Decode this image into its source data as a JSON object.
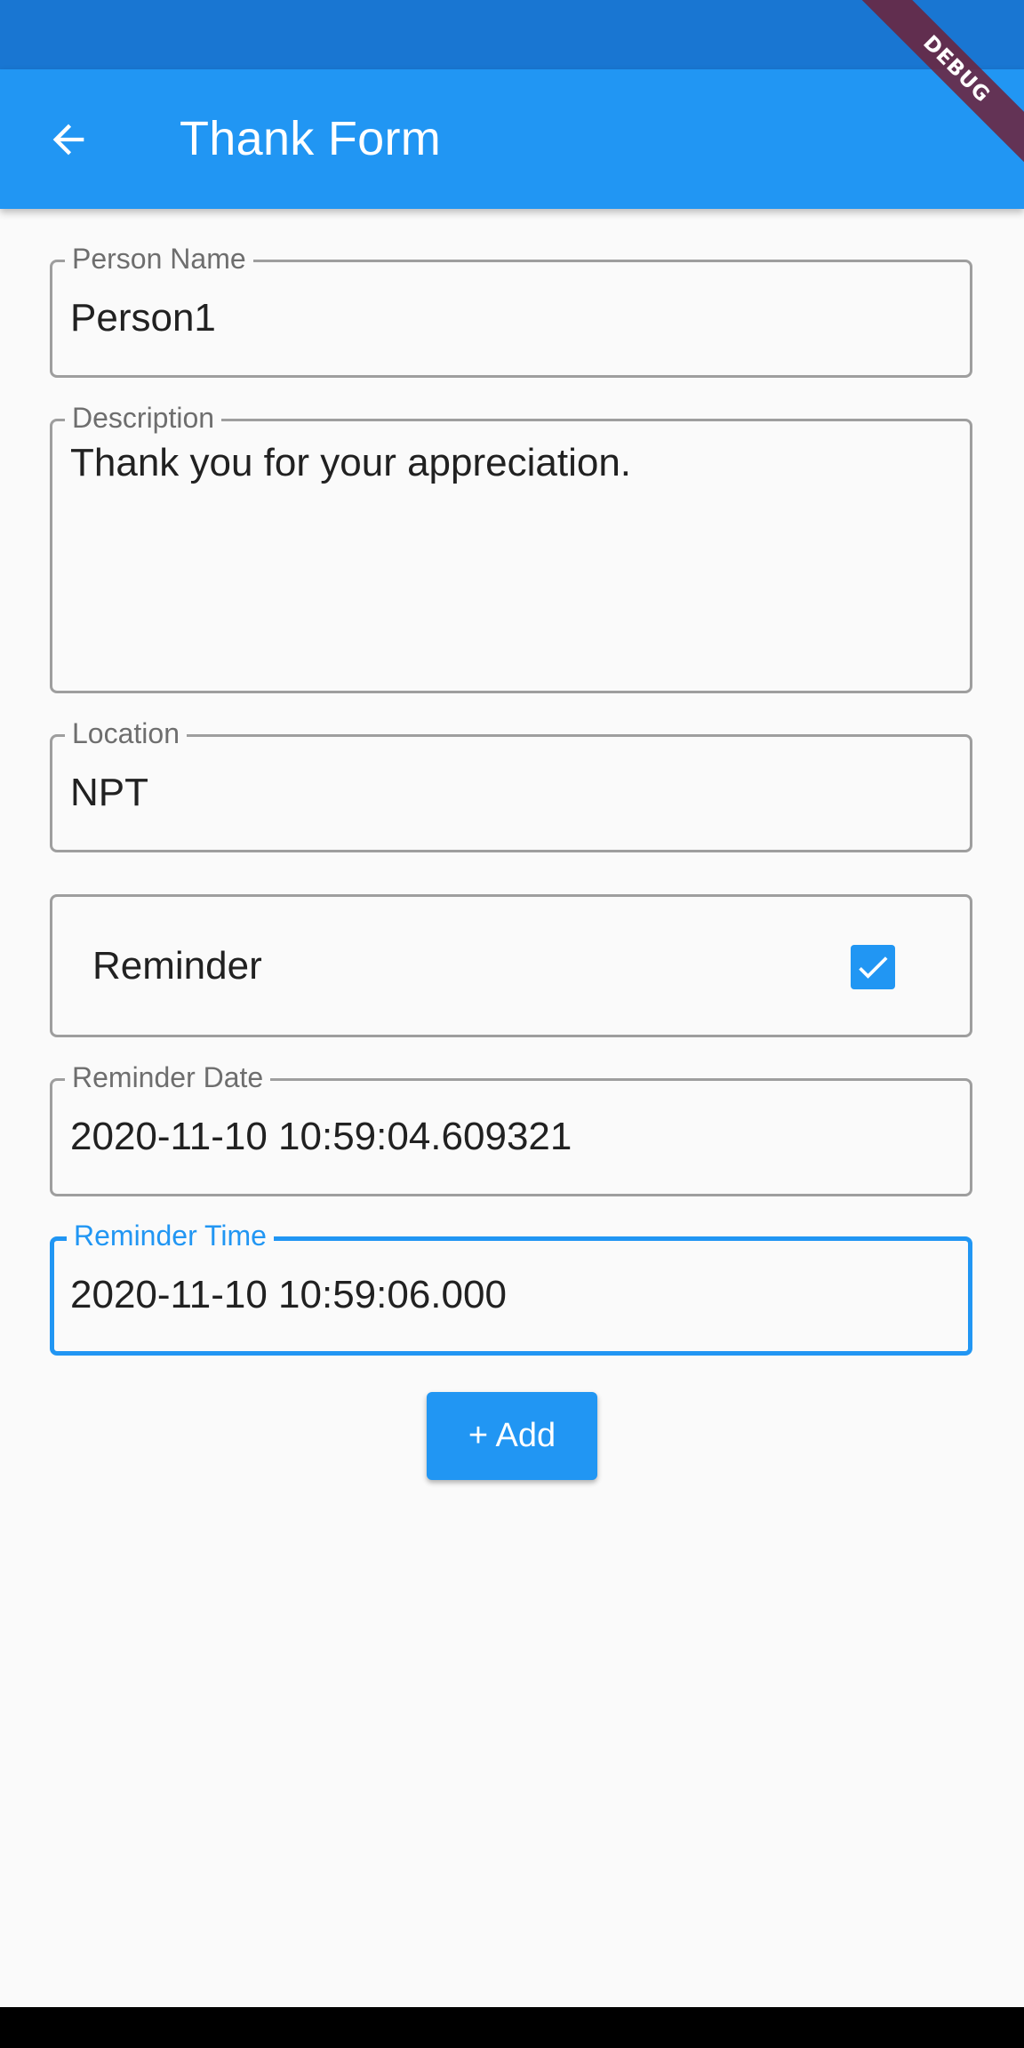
{
  "app_bar": {
    "title": "Thank Form",
    "back_icon": "arrow-back-icon",
    "color": "#2196F3",
    "status_bar_color": "#1976D2"
  },
  "debug_banner": {
    "label": "DEBUG",
    "color": "#6F2238"
  },
  "form": {
    "person_name": {
      "label": "Person Name",
      "value": "Person1"
    },
    "description": {
      "label": "Description",
      "value": "Thank you for your appreciation."
    },
    "location": {
      "label": "Location",
      "value": "NPT"
    },
    "reminder": {
      "label": "Reminder",
      "checked": true,
      "icon": "check-icon"
    },
    "reminder_date": {
      "label": "Reminder Date",
      "value": "2020-11-10 10:59:04.609321"
    },
    "reminder_time": {
      "label": "Reminder Time",
      "value": "2020-11-10 10:59:06.000",
      "focused": true
    },
    "add_button": {
      "label": "+ Add"
    }
  },
  "colors": {
    "accent": "#2196F3",
    "border": "#9E9E9E",
    "background": "#FAFAFA"
  }
}
